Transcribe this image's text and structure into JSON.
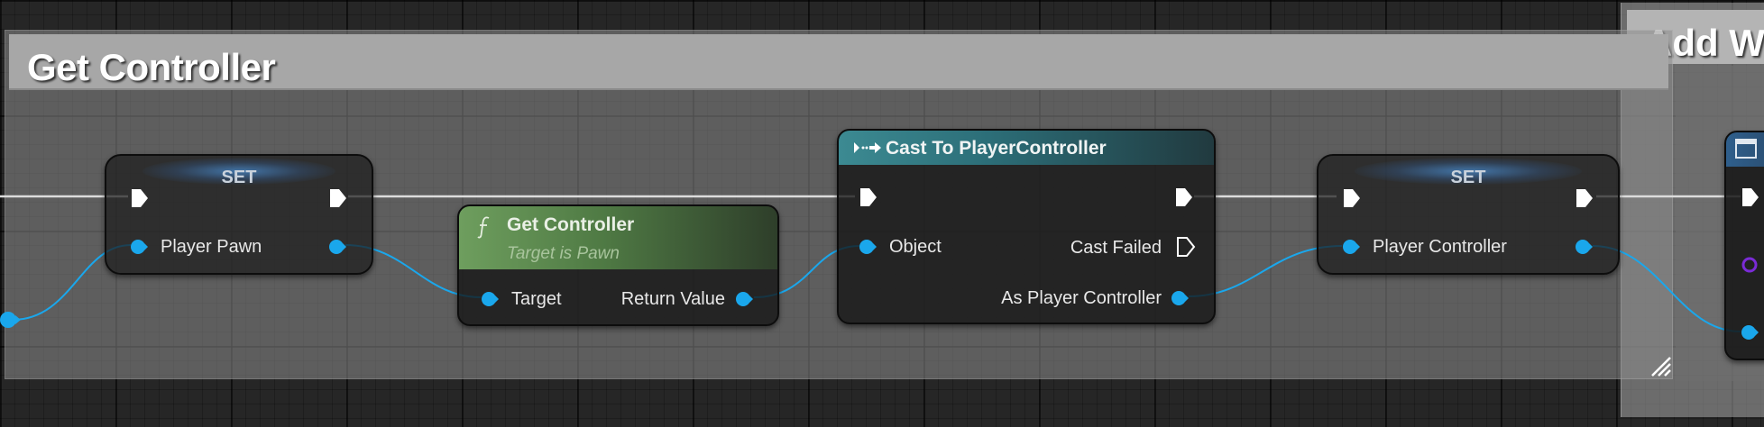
{
  "comments": {
    "main_title": "Get Controller",
    "right_title": "Add Wi"
  },
  "nodes": {
    "set_pawn": {
      "title": "SET",
      "pin_label": "Player Pawn"
    },
    "get_controller": {
      "title": "Get Controller",
      "subtitle": "Target is Pawn",
      "input_label": "Target",
      "output_label": "Return Value",
      "icon": "function-icon"
    },
    "cast": {
      "title": "Cast To PlayerController",
      "input_label": "Object",
      "failed_label": "Cast Failed",
      "output_label": "As Player Controller",
      "icon": "cast-icon"
    },
    "set_controller": {
      "title": "SET",
      "pin_label": "Player Controller"
    }
  },
  "colors": {
    "exec_wire": "#dcdcdc",
    "object_wire": "#1aa7ec",
    "object_pin": "#1aa7ec",
    "purple_pin": "#7a2bd6",
    "function_header": "#6e9e5e",
    "cast_header": "#3c8a92"
  }
}
